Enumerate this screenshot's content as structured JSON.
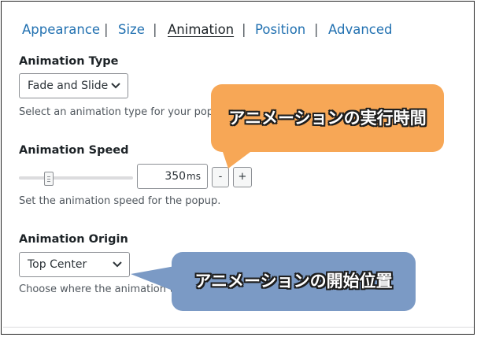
{
  "tabs": [
    {
      "label": "Appearance",
      "active": false
    },
    {
      "label": "Size",
      "active": false
    },
    {
      "label": "Animation",
      "active": true
    },
    {
      "label": "Position",
      "active": false
    },
    {
      "label": "Advanced",
      "active": false
    }
  ],
  "tab_separator": "|",
  "animation_type": {
    "label": "Animation Type",
    "selected": "Fade and Slide",
    "description": "Select an animation type for your popup."
  },
  "animation_speed": {
    "label": "Animation Speed",
    "value": "350",
    "unit": "ms",
    "slider_fraction": 0.24,
    "decrement_label": "-",
    "increment_label": "+",
    "description": "Set the animation speed for the popup."
  },
  "animation_origin": {
    "label": "Animation Origin",
    "selected": "Top Center",
    "description": "Choose where the animation will begin."
  },
  "callouts": {
    "speed_note": "アニメーションの実行時間",
    "origin_note": "アニメーションの開始位置"
  },
  "colors": {
    "link": "#2271b1",
    "orange_callout": "#f7a756",
    "blue_callout": "#7b9ac5"
  }
}
